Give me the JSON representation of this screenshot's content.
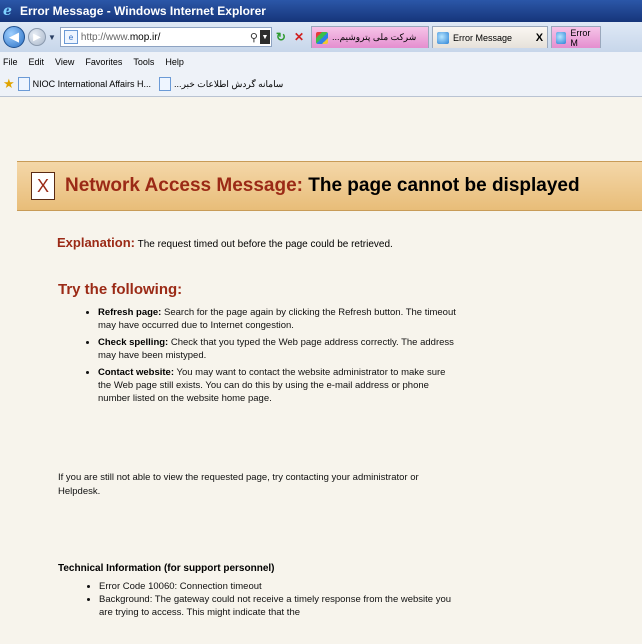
{
  "window": {
    "title": "Error Message - Windows Internet Explorer"
  },
  "navbar": {
    "address_prefix": "http://www.",
    "address_host": "mop.ir/",
    "tabs": [
      {
        "label": "...شرکت ملی پتروشیم"
      },
      {
        "label": "Error Message",
        "close": "X"
      },
      {
        "label": "Error M"
      }
    ]
  },
  "menu": {
    "items": [
      "File",
      "Edit",
      "View",
      "Favorites",
      "Tools",
      "Help"
    ]
  },
  "favorites": {
    "items": [
      "NIOC International Affairs H...",
      "...سامانه گردش اطلاعات خبر"
    ]
  },
  "banner": {
    "prefix": "Network Access Message:",
    "message": "The page cannot be displayed",
    "icon_glyph": "X"
  },
  "explanation": {
    "label": "Explanation:",
    "text": "The request timed out before the page could be retrieved."
  },
  "try_heading": "Try the following:",
  "tips": [
    {
      "label": "Refresh page:",
      "text": "Search for the page again by clicking the Refresh button. The timeout may have occurred due to Internet congestion."
    },
    {
      "label": "Check spelling:",
      "text": "Check that you typed the Web page address correctly. The address may have been mistyped."
    },
    {
      "label": "Contact website:",
      "text": "You may want to contact the website administrator to make sure the Web page still exists. You can do this by using the e-mail address or phone number listed on the website home page."
    }
  ],
  "still_text": "If you are still not able to view the requested page, try contacting your administrator or Helpdesk.",
  "technical": {
    "heading": "Technical Information (for support personnel)",
    "items": [
      "Error Code 10060: Connection timeout",
      "Background: The gateway could not receive a timely response from the website you are trying to access. This might indicate that the"
    ]
  },
  "colors": {
    "accent": "#9b2a16",
    "banner_bg": "#e8bd79",
    "titlebar": "#16357a"
  }
}
